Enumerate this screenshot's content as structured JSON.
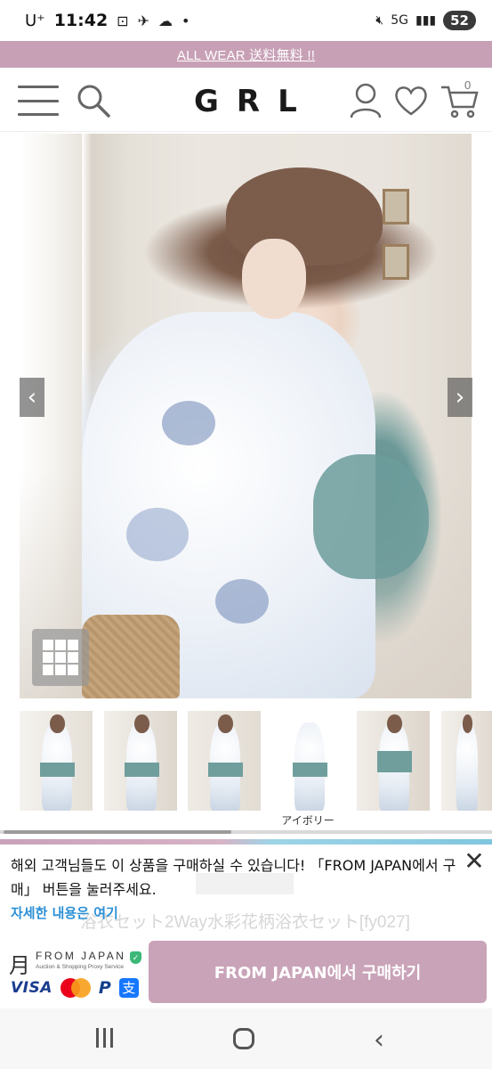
{
  "status": {
    "carrier": "U⁺",
    "time": "11:42",
    "network": "5G",
    "battery": "52"
  },
  "promo": {
    "text": "ALL WEAR 送料無料 !!"
  },
  "header": {
    "logo": "GRL",
    "cart_count": "0"
  },
  "gallery": {
    "prev": "‹",
    "next": "›",
    "thumbnail_caption": "アイボリー",
    "progress": 0.47
  },
  "from_japan": {
    "message": "해외 고객님들도 이 상품을 구매하실 수 있습니다! 「FROM JAPAN에서 구매」 버튼을 눌러주세요.",
    "details_link": "자세한 내용은 여기",
    "ghost_title": "浴衣セット2Way水彩花柄浴衣セット[fy027]",
    "close": "✕",
    "brand_name": "FROM JAPAN",
    "brand_sub": "Auction & Shopping Proxy Service",
    "payment": {
      "visa": "VISA",
      "paypal": "P",
      "alipay": "支"
    },
    "buy_button": "FROM JAPAN에서 구매하기"
  },
  "colors": {
    "brand_pink": "#c9a3b8",
    "promo_pink": "#c7a0b5",
    "link_blue": "#2a8fd6"
  }
}
